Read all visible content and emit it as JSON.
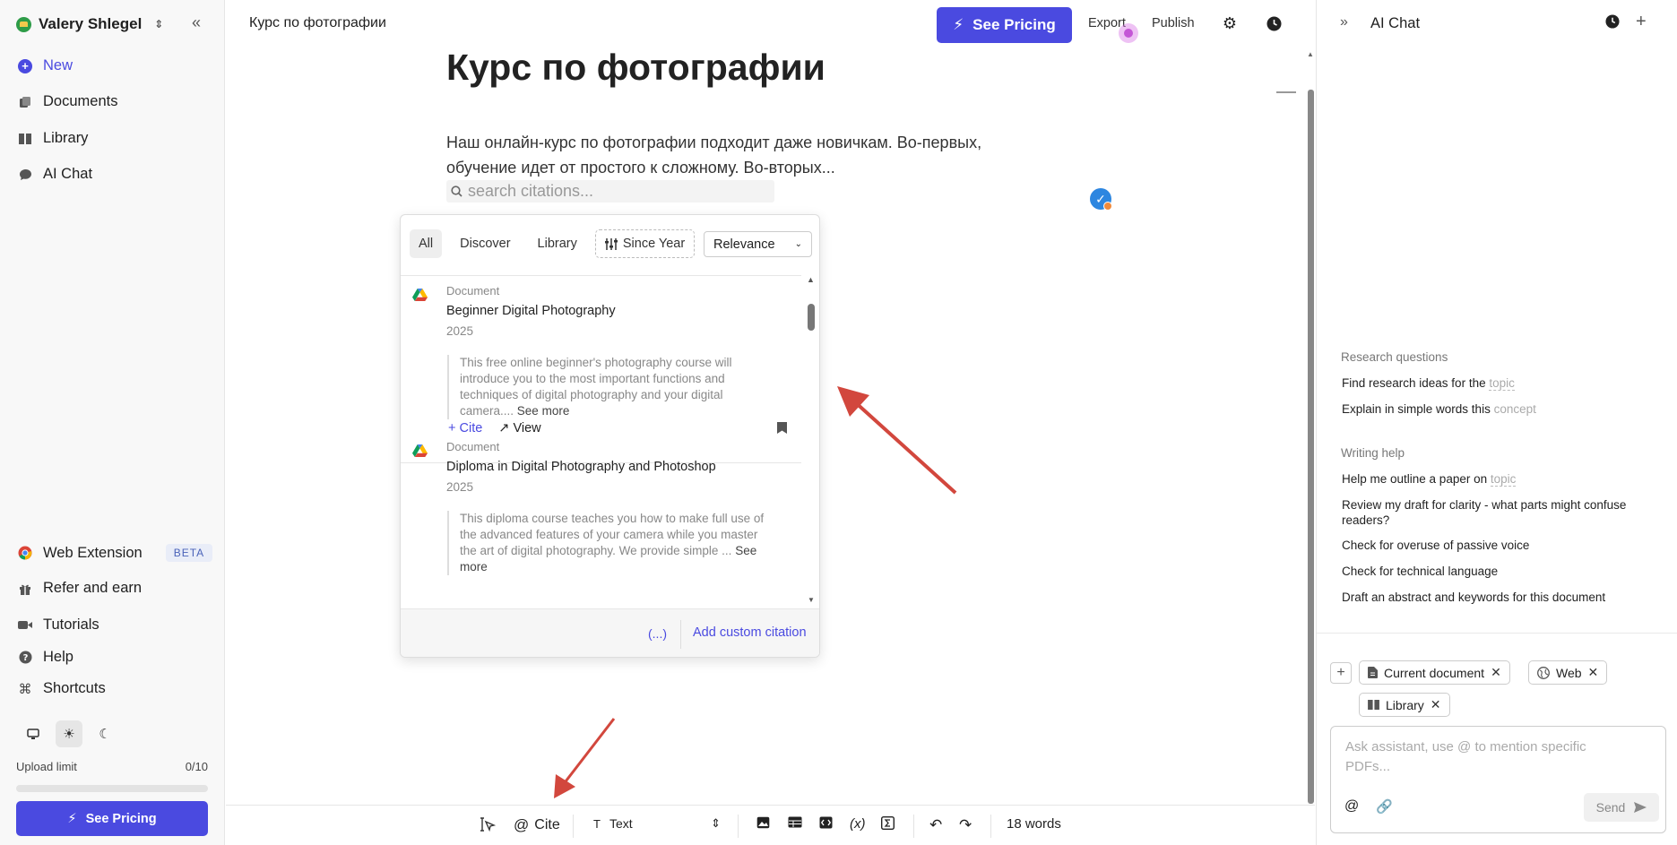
{
  "sidebar": {
    "workspace": "Valery Shlegel",
    "nav": [
      {
        "label": "New",
        "icon": "plus-circle-icon"
      },
      {
        "label": "Documents",
        "icon": "documents-icon"
      },
      {
        "label": "Library",
        "icon": "library-icon"
      },
      {
        "label": "AI Chat",
        "icon": "chat-icon"
      }
    ],
    "bottom": [
      {
        "label": "Web Extension",
        "icon": "chrome-icon",
        "badge": "BETA"
      },
      {
        "label": "Refer and earn",
        "icon": "gift-icon"
      },
      {
        "label": "Tutorials",
        "icon": "video-icon"
      },
      {
        "label": "Help",
        "icon": "help-icon"
      },
      {
        "label": "Shortcuts",
        "icon": "command-icon"
      }
    ],
    "upload_label": "Upload limit",
    "upload_count": "0/10",
    "upload_fraction": 0,
    "pricing_label": "See Pricing"
  },
  "header": {
    "doc_title": "Курс по фотографии",
    "pricing_label": "See Pricing",
    "export_label": "Export",
    "publish_label": "Publish"
  },
  "document": {
    "heading": "Курс по фотографии",
    "paragraph_line1": "Наш онлайн-курс по фотографии подходит даже новичкам. Во-первых,",
    "paragraph_line2": "обучение идет от простого к сложному. Во-вторых...",
    "search_placeholder": "search citations..."
  },
  "citation_popup": {
    "tabs": [
      "All",
      "Discover",
      "Library"
    ],
    "since_year": "Since Year",
    "sort": "Relevance",
    "results": [
      {
        "type": "Document",
        "title": "Beginner Digital Photography",
        "year": "2025",
        "abstract_lines": [
          "This free online beginner's photography course will",
          "introduce you to the most important functions and",
          "techniques of digital photography and your digital",
          "camera...."
        ],
        "see_more": "See more",
        "cite": "Cite",
        "view": "View"
      },
      {
        "type": "Document",
        "title": "Diploma in Digital Photography and Photoshop",
        "year": "2025",
        "abstract_lines": [
          "This diploma course teaches you how to make full use of",
          "the advanced features of your camera while you master",
          "the art of digital photography. We provide simple ..."
        ],
        "see_more": "See more"
      }
    ],
    "bracket_icon": "(...)",
    "add_custom": "Add custom citation"
  },
  "toolbar": {
    "cite_label": "Cite",
    "text_style": "Text",
    "word_count": "18 words"
  },
  "right_panel": {
    "title": "AI Chat",
    "research_title": "Research questions",
    "research": [
      {
        "text": "Find research ideas for the ",
        "hint": "topic"
      },
      {
        "text": "Explain in simple words this ",
        "hint": "concept"
      }
    ],
    "writing_title": "Writing help",
    "writing": [
      {
        "text": "Help me outline a paper on ",
        "hint": "topic"
      },
      {
        "text": "Review my draft for clarity - what parts might confuse readers?"
      },
      {
        "text": "Check for overuse of passive voice"
      },
      {
        "text": "Check for technical language"
      },
      {
        "text": "Draft an abstract and keywords for this document"
      }
    ],
    "chips": [
      "Current document",
      "Web",
      "Library"
    ],
    "ask_placeholder": "Ask assistant, use @ to mention specific PDFs...",
    "send_label": "Send"
  },
  "colors": {
    "accent": "#4a4ae0",
    "arrow": "#d2473d"
  }
}
